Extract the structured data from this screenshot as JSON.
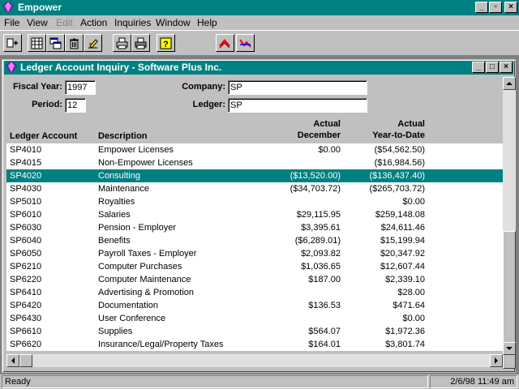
{
  "app": {
    "title": "Empower"
  },
  "menu": {
    "file": "File",
    "view": "View",
    "edit": "Edit",
    "action": "Action",
    "inquiries": "Inquiries",
    "window": "Window",
    "help": "Help"
  },
  "toolbar": {
    "icons": [
      "add-record-icon",
      "grid-icon",
      "windows-icon",
      "trash-icon",
      "edit-icon",
      "print-icon",
      "print-preview-icon",
      "help-icon",
      "up-chart-icon",
      "down-chart-icon"
    ]
  },
  "child": {
    "title": "Ledger Account Inquiry - Software Plus Inc."
  },
  "form": {
    "fiscal_year_label": "Fiscal Year:",
    "fiscal_year": "1997",
    "period_label": "Period:",
    "period": "12",
    "company_label": "Company:",
    "company": "SP",
    "ledger_label": "Ledger:",
    "ledger": "SP"
  },
  "grid": {
    "headers": {
      "account": "Ledger Account",
      "description": "Description",
      "dec_line1": "Actual",
      "dec_line2": "December",
      "ytd_line1": "Actual",
      "ytd_line2": "Year-to-Date"
    },
    "selected_index": 2,
    "rows": [
      {
        "account": "SP4010",
        "description": "Empower Licenses",
        "december": "$0.00",
        "ytd": "($54,562.50)"
      },
      {
        "account": "SP4015",
        "description": "Non-Empower Licenses",
        "december": "",
        "ytd": "($16,984.56)"
      },
      {
        "account": "SP4020",
        "description": "Consulting",
        "december": "($13,520.00)",
        "ytd": "($136,437.40)"
      },
      {
        "account": "SP4030",
        "description": "Maintenance",
        "december": "($34,703.72)",
        "ytd": "($265,703.72)"
      },
      {
        "account": "SP5010",
        "description": "Royalties",
        "december": "",
        "ytd": "$0.00"
      },
      {
        "account": "SP6010",
        "description": "Salaries",
        "december": "$29,115.95",
        "ytd": "$259,148.08"
      },
      {
        "account": "SP6030",
        "description": "Pension - Employer",
        "december": "$3,395.61",
        "ytd": "$24,611.46"
      },
      {
        "account": "SP6040",
        "description": "Benefits",
        "december": "($6,289.01)",
        "ytd": "$15,199.94"
      },
      {
        "account": "SP6050",
        "description": "Payroll Taxes - Employer",
        "december": "$2,093.82",
        "ytd": "$20,347.92"
      },
      {
        "account": "SP6210",
        "description": "Computer Purchases",
        "december": "$1,036.65",
        "ytd": "$12,607.44"
      },
      {
        "account": "SP6220",
        "description": "Computer Maintenance",
        "december": "$187.00",
        "ytd": "$2,339.10"
      },
      {
        "account": "SP6410",
        "description": "Advertising & Promotion",
        "december": "",
        "ytd": "$28.00"
      },
      {
        "account": "SP6420",
        "description": "Documentation",
        "december": "$136.53",
        "ytd": "$471.64"
      },
      {
        "account": "SP6430",
        "description": "User Conference",
        "december": "",
        "ytd": "$0.00"
      },
      {
        "account": "SP6610",
        "description": "Supplies",
        "december": "$564.07",
        "ytd": "$1,972.36"
      },
      {
        "account": "SP6620",
        "description": "Insurance/Legal/Property Taxes",
        "december": "$164.01",
        "ytd": "$3,801.74"
      }
    ]
  },
  "status": {
    "left": "Ready",
    "right": "2/6/98 11:49 am"
  },
  "colors": {
    "titlebar": "#008080",
    "selection": "#008080",
    "face": "#c0c0c0",
    "workspace": "#808080"
  }
}
